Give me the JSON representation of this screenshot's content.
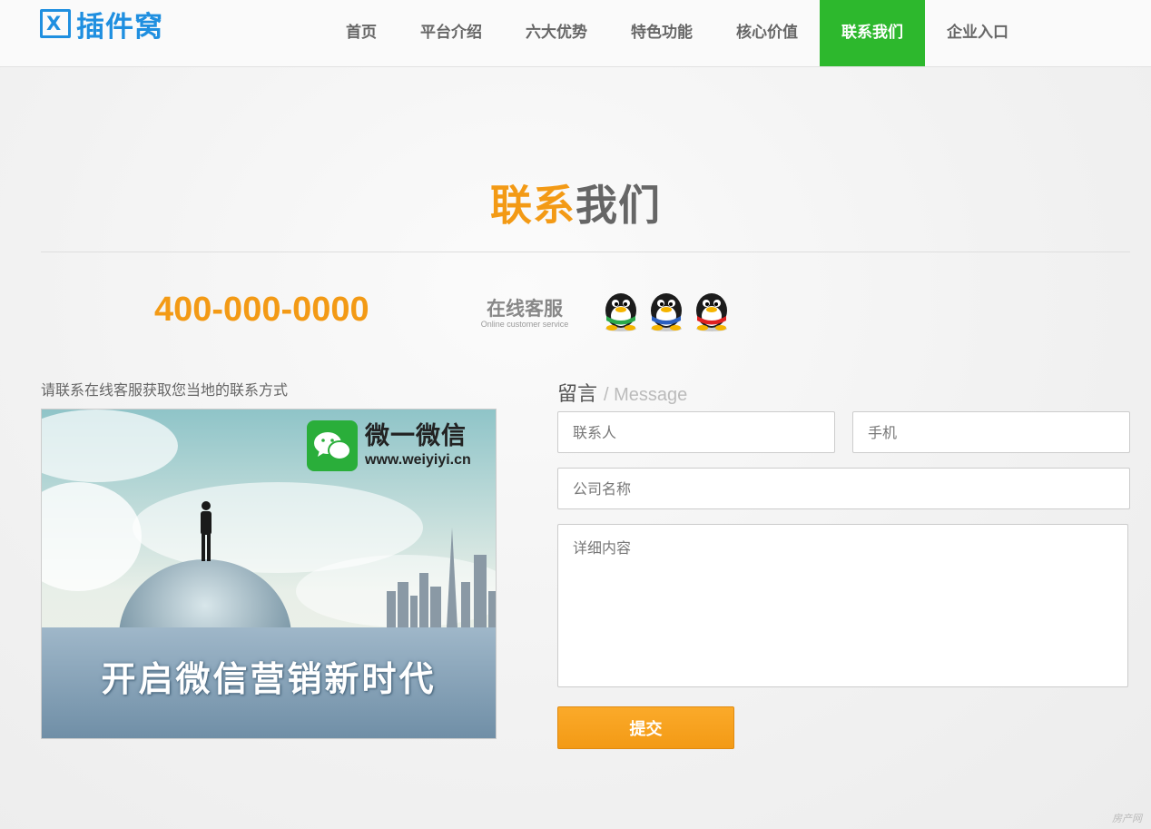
{
  "brand": {
    "name": "插件窝",
    "mark_letter": "X",
    "color": "#1f8fe0"
  },
  "nav": {
    "items": [
      {
        "label": "首页"
      },
      {
        "label": "平台介绍"
      },
      {
        "label": "六大优势"
      },
      {
        "label": "特色功能"
      },
      {
        "label": "核心价值"
      },
      {
        "label": "联系我们",
        "active": true
      },
      {
        "label": "企业入口"
      }
    ],
    "active_color": "#2db82d"
  },
  "section": {
    "title_highlight": "联系",
    "title_rest": "我们",
    "accent": "#f39a15"
  },
  "contact": {
    "phone": "400-000-0000",
    "cs_title": "在线客服",
    "cs_subtitle": "Online customer service",
    "qq_icons": [
      "qq-penguin-green-icon",
      "qq-penguin-blue-icon",
      "qq-penguin-red-icon"
    ]
  },
  "left": {
    "note": "请联系在线客服获取您当地的联系方式",
    "banner": {
      "wx_name": "微一微信",
      "wx_url": "www.weiyiyi.cn",
      "slogan": "开启微信营销新时代"
    }
  },
  "form": {
    "title": "留言",
    "title_en": "/ Message",
    "name_placeholder": "联系人",
    "phone_placeholder": "手机",
    "company_placeholder": "公司名称",
    "detail_placeholder": "详细内容",
    "submit_label": "提交"
  },
  "corner_mark": "房产网"
}
